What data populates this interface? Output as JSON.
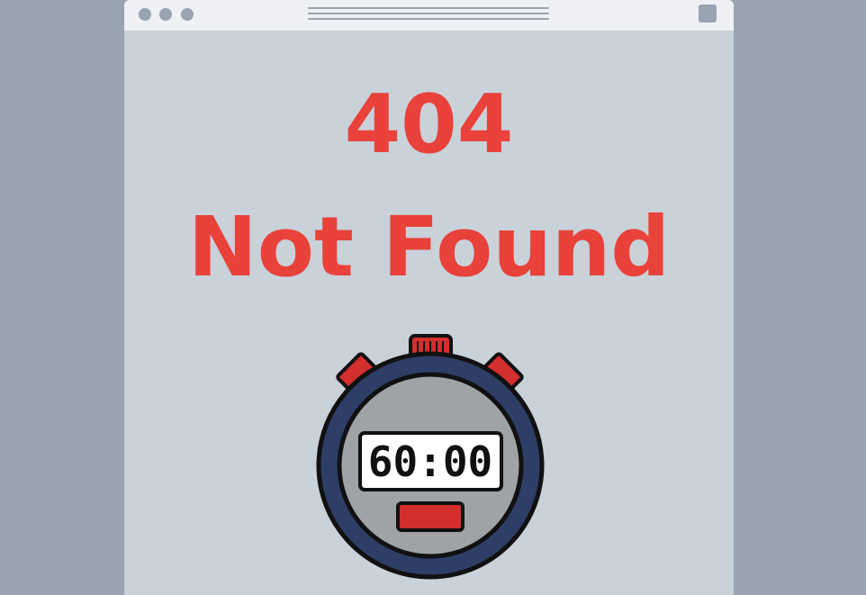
{
  "error": {
    "code": "404",
    "message": "Not Found"
  },
  "stopwatch": {
    "display": "60:00"
  },
  "colors": {
    "background": "#98a4b1",
    "window": "#c9d1d9",
    "title_bar": "#eef0f3",
    "accent_red": "#e8423b",
    "stopwatch_ring": "#2e3e66",
    "stopwatch_face": "#9fa3a6",
    "button_red": "#d32f2f"
  }
}
